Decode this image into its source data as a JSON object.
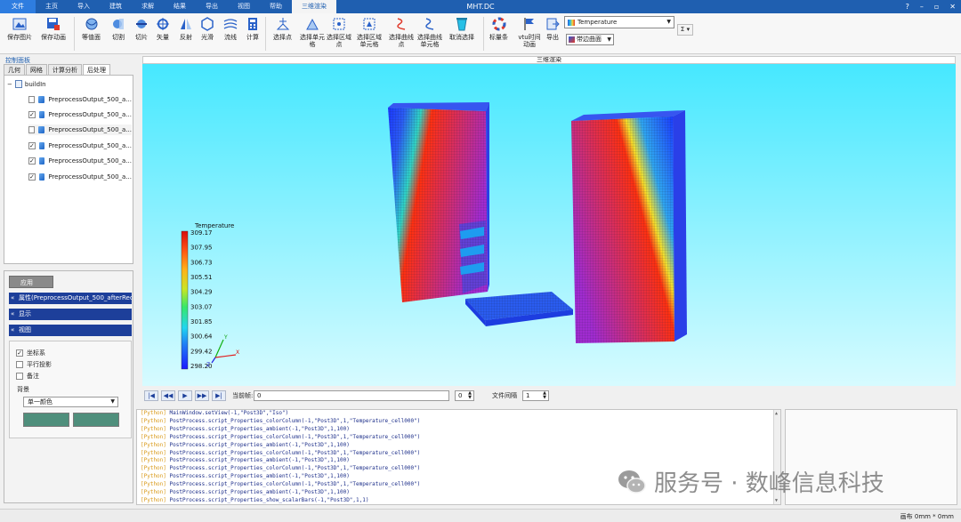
{
  "app_title": "MHT.DC",
  "window_controls": [
    "?",
    "–",
    "▫",
    "✕"
  ],
  "ribbon_tabs": [
    "文件",
    "主页",
    "导入",
    "建筑",
    "求解",
    "结果",
    "导出",
    "视图",
    "帮助",
    "三维渲染"
  ],
  "ribbon": {
    "buttons": [
      "保存图片",
      "保存动画",
      "等值面",
      "切割",
      "切片",
      "矢量",
      "反射",
      "光滑",
      "流线",
      "计算",
      "选择点",
      "选择单元格",
      "选择区域点",
      "选择区域单元格",
      "选择曲线点",
      "选择曲线单元格",
      "取消选择",
      "标量条",
      "vtu时间动画",
      "导出"
    ],
    "scalar_value": "Temperature",
    "mode_value": "带边曲面",
    "sigma": "Σ"
  },
  "left_panel": {
    "title": "控制面板",
    "tabs": [
      "几何",
      "网格",
      "计算分析",
      "后处理"
    ],
    "tree": {
      "root": "buildIn",
      "items": [
        {
          "label": "PreprocessOutput_500_a...",
          "checked": false
        },
        {
          "label": "PreprocessOutput_500_a...",
          "checked": true
        },
        {
          "label": "PreprocessOutput_500_a...",
          "checked": false
        },
        {
          "label": "PreprocessOutput_500_a...",
          "checked": true
        },
        {
          "label": "PreprocessOutput_500_a...",
          "checked": true
        },
        {
          "label": "PreprocessOutput_500_a...",
          "checked": true
        }
      ]
    },
    "apply_label": "应用",
    "sections": [
      "属性(PreprocessOutput_500_afterRecon",
      "显示",
      "视图"
    ],
    "view_options": [
      {
        "label": "坐标系",
        "checked": true
      },
      {
        "label": "平行投影",
        "checked": false
      },
      {
        "label": "备注",
        "checked": false
      }
    ],
    "background_label": "背景",
    "background_value": "单一颜色",
    "background_colors": [
      "#4f8f7c",
      "#4f8f7c"
    ]
  },
  "viewport": {
    "title": "三维渲染",
    "scalar_bar": {
      "title": "Temperature",
      "labels": [
        "309.17",
        "307.95",
        "306.73",
        "305.51",
        "304.29",
        "303.07",
        "301.85",
        "300.64",
        "299.42",
        "298.20"
      ]
    },
    "axes": [
      "X",
      "Y",
      "Z"
    ],
    "background_top": "#46e8ff",
    "background_bottom": "#d7fbff"
  },
  "playback": {
    "buttons": [
      "first",
      "prev",
      "play",
      "next",
      "last"
    ],
    "frame_label": "当前帧:",
    "frame_value": "0",
    "frame_spin": "0",
    "interval_label": "文件间隔",
    "interval_value": "1"
  },
  "console": {
    "lines": [
      {
        "tag": "[Python]",
        "text": " MainWindow.setView(-1,\"Post3D\",\"Iso\")"
      },
      {
        "tag": "[Python]",
        "text": " PostProcess.script_Properties_colorColumn(-1,\"Post3D\",1,\"Temperature_cell000\")"
      },
      {
        "tag": "[Python]",
        "text": " PostProcess.script_Properties_ambient(-1,\"Post3D\",1,100)"
      },
      {
        "tag": "[Python]",
        "text": " PostProcess.script_Properties_colorColumn(-1,\"Post3D\",1,\"Temperature_cell000\")"
      },
      {
        "tag": "[Python]",
        "text": " PostProcess.script_Properties_ambient(-1,\"Post3D\",1,100)"
      },
      {
        "tag": "[Python]",
        "text": " PostProcess.script_Properties_colorColumn(-1,\"Post3D\",1,\"Temperature_cell000\")"
      },
      {
        "tag": "[Python]",
        "text": " PostProcess.script_Properties_ambient(-1,\"Post3D\",1,100)"
      },
      {
        "tag": "[Python]",
        "text": " PostProcess.script_Properties_colorColumn(-1,\"Post3D\",1,\"Temperature_cell000\")"
      },
      {
        "tag": "[Python]",
        "text": " PostProcess.script_Properties_ambient(-1,\"Post3D\",1,100)"
      },
      {
        "tag": "[Python]",
        "text": " PostProcess.script_Properties_colorColumn(-1,\"Post3D\",1,\"Temperature_cell000\")"
      },
      {
        "tag": "[Python]",
        "text": " PostProcess.script_Properties_ambient(-1,\"Post3D\",1,100)"
      },
      {
        "tag": "[Python]",
        "text": " PostProcess.script_Properties_show_scalarBars(-1,\"Post3D\",1,1)"
      }
    ]
  },
  "status": "画布 0mm * 0mm",
  "watermark": "服务号 · 数峰信息科技"
}
